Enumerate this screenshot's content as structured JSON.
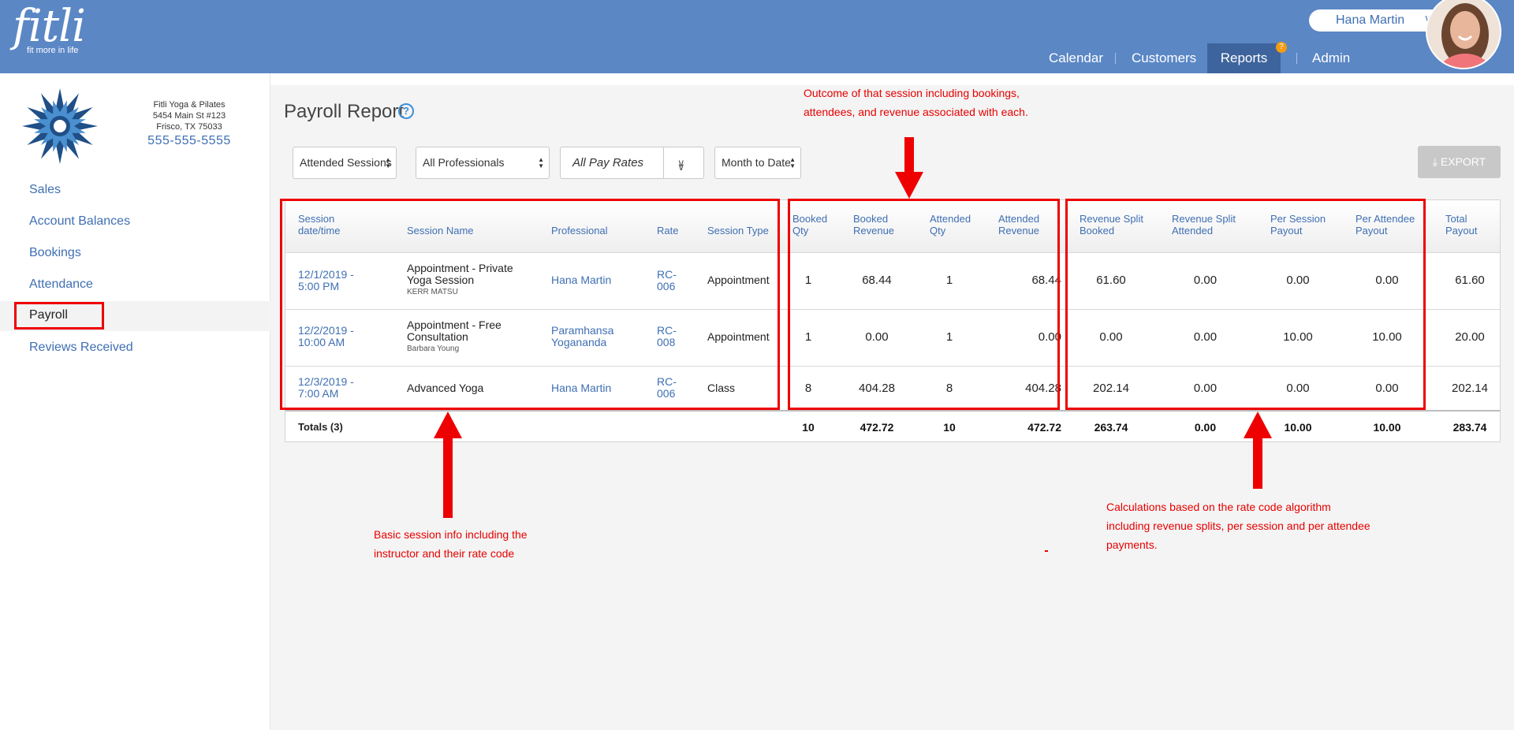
{
  "header": {
    "logo_word": "fitli",
    "logo_tagline": "fit more in life",
    "user_name": "Hana Martin",
    "user_chevron": "chevron-down-double",
    "nav": [
      {
        "label": "Calendar"
      },
      {
        "label": "Customers"
      },
      {
        "label": "Reports"
      },
      {
        "label": "Admin"
      }
    ],
    "reports_badge": "?",
    "colors": {
      "bar": "#5b87c5",
      "active_tab": "#3e649d",
      "badge": "#f39c12"
    }
  },
  "business": {
    "name": "Fitli Yoga & Pilates",
    "address1": "5454 Main St #123",
    "address2": "Frisco, TX 75033",
    "phone": "555-555-5555"
  },
  "sidebar": {
    "items": [
      {
        "label": "Sales"
      },
      {
        "label": "Account Balances"
      },
      {
        "label": "Bookings"
      },
      {
        "label": "Attendance"
      },
      {
        "label": "Payroll"
      },
      {
        "label": "Reviews Received"
      }
    ],
    "active": "Payroll"
  },
  "report": {
    "title": "Payroll Report",
    "filters": {
      "session_filter": "Attended Sessions",
      "professional_filter": "All Professionals",
      "pay_rate_filter": "All Pay Rates",
      "date_filter": "Month to Date"
    },
    "export_label": "EXPORT",
    "columns": [
      "Session date/time",
      "Session Name",
      "Professional",
      "Rate",
      "Session Type",
      "Booked Qty",
      "Booked Revenue",
      "Attended Qty",
      "Attended Revenue",
      "Revenue Split Booked",
      "Revenue Split Attended",
      "Per Session Payout",
      "Per Attendee Payout",
      "Total Payout"
    ],
    "rows": [
      {
        "datetime_1": "12/1/2019 -",
        "datetime_2": "5:00 PM",
        "session_1": "Appointment - Private",
        "session_2": "Yoga Session",
        "customer": "KERR MATSU",
        "professional_1": "Hana Martin",
        "professional_2": "",
        "rate_1": "RC-",
        "rate_2": "006",
        "type": "Appointment",
        "booked_qty": "1",
        "booked_rev": "68.44",
        "attended_qty": "1",
        "attended_rev": "68.44",
        "split_booked": "61.60",
        "split_attended": "0.00",
        "per_session": "0.00",
        "per_attendee": "0.00",
        "total": "61.60"
      },
      {
        "datetime_1": "12/2/2019 -",
        "datetime_2": "10:00 AM",
        "session_1": "Appointment - Free",
        "session_2": "Consultation",
        "customer": "Barbara Young",
        "professional_1": "Paramhansa",
        "professional_2": "Yogananda",
        "rate_1": "RC-",
        "rate_2": "008",
        "type": "Appointment",
        "booked_qty": "1",
        "booked_rev": "0.00",
        "attended_qty": "1",
        "attended_rev": "0.00",
        "split_booked": "0.00",
        "split_attended": "0.00",
        "per_session": "10.00",
        "per_attendee": "10.00",
        "total": "20.00"
      },
      {
        "datetime_1": "12/3/2019 -",
        "datetime_2": "7:00 AM",
        "session_1": "Advanced Yoga",
        "session_2": "",
        "customer": "",
        "professional_1": "Hana Martin",
        "professional_2": "",
        "rate_1": "RC-",
        "rate_2": "006",
        "type": "Class",
        "booked_qty": "8",
        "booked_rev": "404.28",
        "attended_qty": "8",
        "attended_rev": "404.28",
        "split_booked": "202.14",
        "split_attended": "0.00",
        "per_session": "0.00",
        "per_attendee": "0.00",
        "total": "202.14"
      }
    ],
    "totals": {
      "label": "Totals (3)",
      "booked_qty": "10",
      "booked_rev": "472.72",
      "attended_qty": "10",
      "attended_rev": "472.72",
      "split_booked": "263.74",
      "split_attended": "0.00",
      "per_session": "10.00",
      "per_attendee": "10.00",
      "total": "283.74"
    }
  },
  "annotations": {
    "top": [
      "Outcome of that session including bookings,",
      "attendees, and revenue associated with each."
    ],
    "bottom_left": [
      "Basic session info including the",
      "instructor and their rate code"
    ],
    "bottom_right": [
      "Calculations based on the rate code algorithm",
      "including revenue splits, per session and per attendee",
      "payments."
    ],
    "color": "#ee0000"
  }
}
